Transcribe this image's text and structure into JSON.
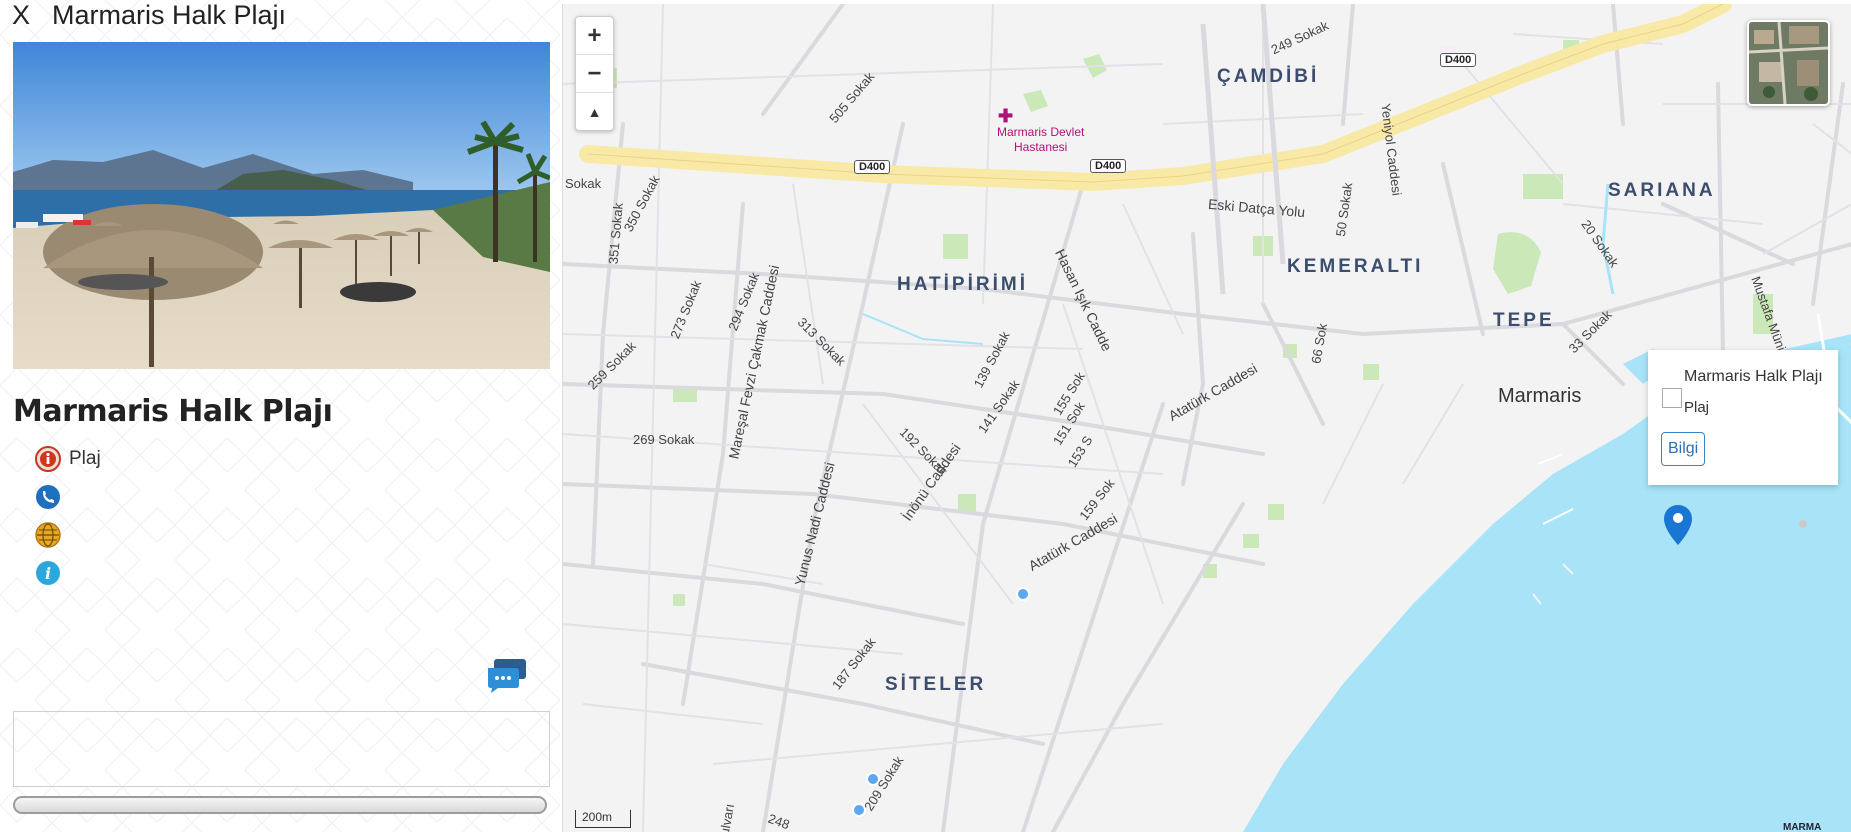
{
  "sidebar": {
    "close_label": "X",
    "header_title": "Marmaris Halk Plajı",
    "place_title": "Marmaris Halk Plajı",
    "category": "Plaj",
    "icons": [
      "info-circle-icon",
      "phone-icon",
      "globe-icon",
      "info-icon"
    ]
  },
  "map": {
    "zoom_in": "+",
    "zoom_out": "−",
    "compass": "▲",
    "scale": "200m",
    "popup": {
      "title": "Marmaris Halk Plajı",
      "category": "Plaj",
      "button": "Bilgi"
    },
    "districts": [
      "ÇAMDİBİ",
      "HATİPİRİMİ",
      "KEMERALTI",
      "SARIANA",
      "TEPE",
      "SİTELER"
    ],
    "town": "Marmaris",
    "poi": {
      "name_line1": "Marmaris Devlet",
      "name_line2": "Hastanesi"
    },
    "shields": [
      "D400",
      "D400",
      "D400"
    ],
    "roads": [
      "249 Sokak",
      "505 Sokak",
      "Yeniyol Caddesi",
      "Eski Datça Yolu",
      "Sokak",
      "350 Sokak",
      "351 Sokak",
      "20 Sokak",
      "50 Sokak",
      "Mustafa Münir Elgin Bulvarı",
      "Hasan Işık Cadde",
      "Atatürk Caddesi",
      "Atatürk Caddesi",
      "Mareşal Fevzi Çakmak Caddesi",
      "Yunus Nadi Caddesi",
      "İnönü Caddesi",
      "273 Sokak",
      "294 Sokak",
      "313 Sokak",
      "259 Sokak",
      "269 Sokak",
      "139 Sokak",
      "141 Sokak",
      "155 Sok",
      "151 Sok",
      "153 S",
      "159 Sok",
      "192 Sokak",
      "187 Sokak",
      "209 Sokak",
      "33 Sokak",
      "66 Sok",
      "248",
      "ulvarı"
    ],
    "attribution": "MARMA",
    "colors": {
      "sea": "#a8e3f8",
      "highway": "#f8e9a6",
      "park": "#cbe8b8",
      "pin": "#1976d2",
      "district": "#3c4d6d",
      "hospital": "#b0107a"
    }
  }
}
